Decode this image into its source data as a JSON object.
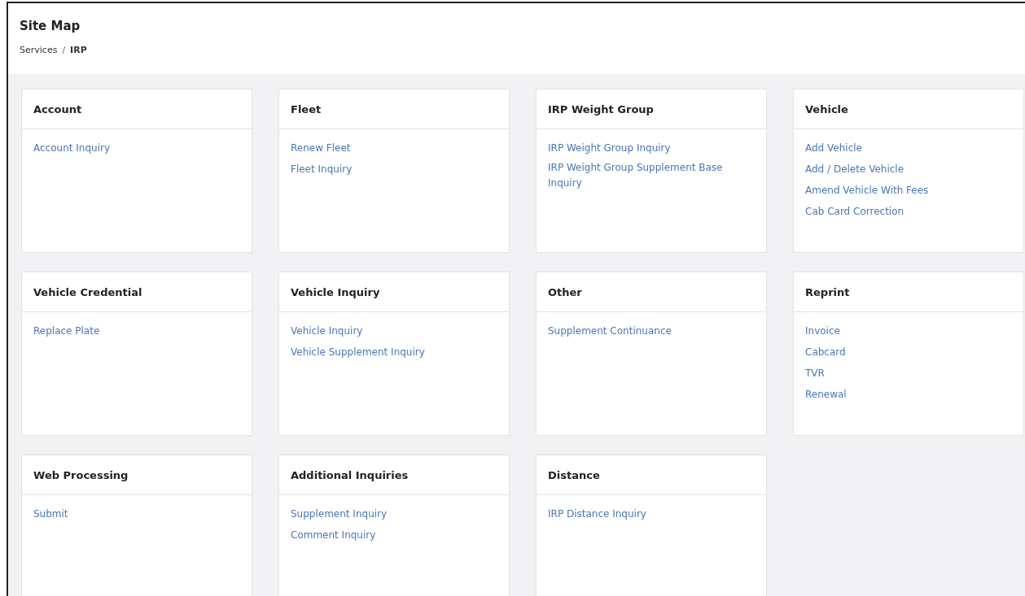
{
  "header": {
    "title": "Site Map",
    "separator": "/",
    "breadcrumb": [
      {
        "label": "Services",
        "current": false
      },
      {
        "label": "IRP",
        "current": true
      }
    ]
  },
  "cards": [
    {
      "title": "Account",
      "links": [
        "Account Inquiry"
      ]
    },
    {
      "title": "Fleet",
      "links": [
        "Renew Fleet",
        "Fleet Inquiry"
      ]
    },
    {
      "title": "IRP Weight Group",
      "links": [
        "IRP Weight Group Inquiry",
        "IRP Weight Group Supplement Base Inquiry"
      ]
    },
    {
      "title": "Vehicle",
      "links": [
        "Add Vehicle",
        "Add / Delete Vehicle",
        "Amend Vehicle With Fees",
        "Cab Card Correction"
      ]
    },
    {
      "title": "Vehicle Credential",
      "links": [
        "Replace Plate"
      ]
    },
    {
      "title": "Vehicle Inquiry",
      "links": [
        "Vehicle Inquiry",
        "Vehicle Supplement Inquiry"
      ]
    },
    {
      "title": "Other",
      "links": [
        "Supplement Continuance"
      ]
    },
    {
      "title": "Reprint",
      "links": [
        "Invoice",
        "Cabcard",
        "TVR",
        "Renewal"
      ]
    },
    {
      "title": "Web Processing",
      "links": [
        "Submit"
      ]
    },
    {
      "title": "Additional Inquiries",
      "links": [
        "Supplement Inquiry",
        "Comment Inquiry"
      ]
    },
    {
      "title": "Distance",
      "links": [
        "IRP Distance Inquiry"
      ]
    }
  ]
}
